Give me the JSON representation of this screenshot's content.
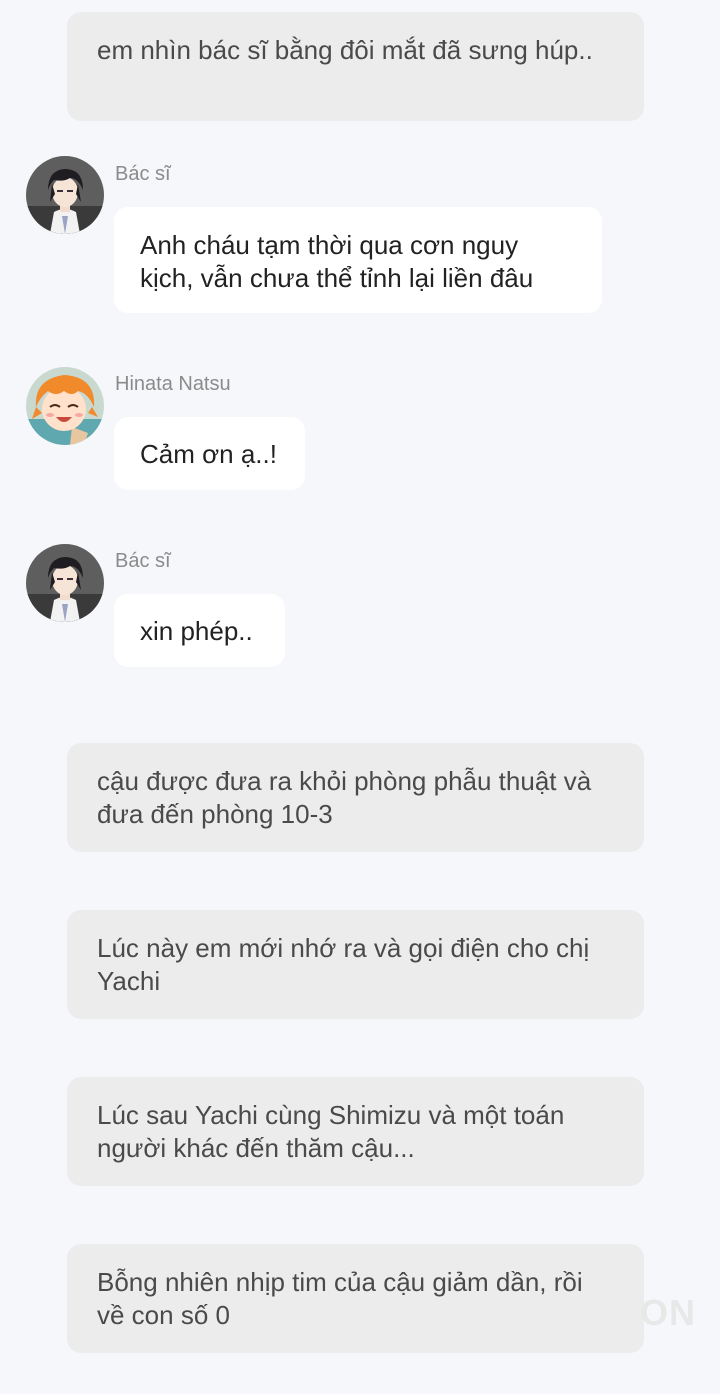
{
  "messages": [
    {
      "type": "narration",
      "text": "em nhìn bác sĩ bằng đôi mắt đã sưng húp.."
    },
    {
      "type": "chat",
      "sender": "Bác sĩ",
      "avatar": "doctor-avatar",
      "text": "Anh cháu tạm thời qua cơn nguy kịch, vẫn chưa thể tỉnh lại liền đâu"
    },
    {
      "type": "chat",
      "sender": "Hinata Natsu",
      "avatar": "natsu-avatar",
      "text": "Cảm ơn ạ..!"
    },
    {
      "type": "chat",
      "sender": "Bác sĩ",
      "avatar": "doctor-avatar",
      "text": "xin phép.."
    },
    {
      "type": "narration",
      "text": "cậu được đưa ra khỏi phòng phẫu thuật và đưa đến phòng 10-3"
    },
    {
      "type": "narration",
      "text": "Lúc này em mới nhớ ra và gọi điện cho chị Yachi"
    },
    {
      "type": "narration",
      "text": "Lúc sau Yachi cùng Shimizu và một toán người khác đến thăm cậu..."
    },
    {
      "type": "narration",
      "text": "Bỗng nhiên nhịp tim của cậu giảm dần, rồi về con số 0"
    }
  ],
  "watermark": "ON"
}
